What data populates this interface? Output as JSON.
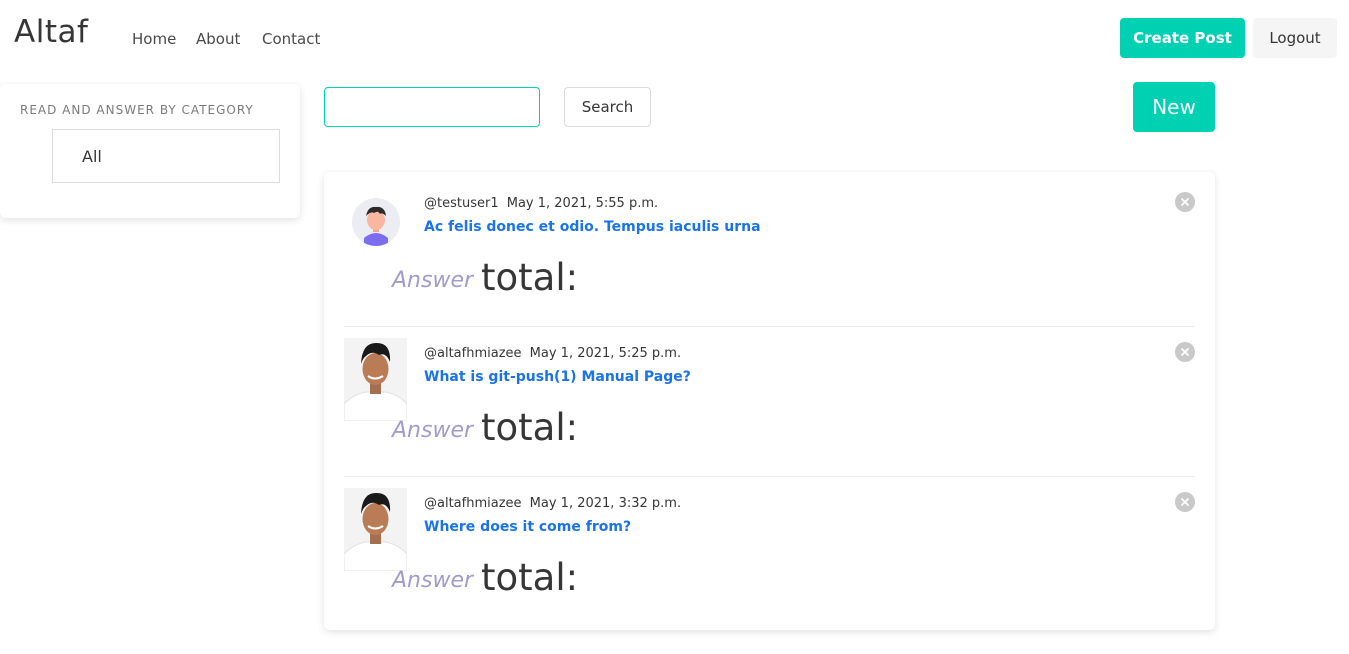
{
  "navbar": {
    "brand": "Altaf",
    "links": [
      "Home",
      "About",
      "Contact"
    ],
    "create_post_label": "Create Post",
    "logout_label": "Logout"
  },
  "sidebar": {
    "title": "Read and Answer by Category",
    "items": [
      "All"
    ]
  },
  "search": {
    "value": "",
    "placeholder": "",
    "button_label": "Search"
  },
  "new_button_label": "New",
  "posts": [
    {
      "username": "@testuser1",
      "date": "May 1, 2021, 5:55 p.m.",
      "title": "Ac felis donec et odio. Tempus iaculis urna",
      "answer_label": "Answer",
      "total_label": "total:",
      "avatar": "default-avatar"
    },
    {
      "username": "@altafhmiazee",
      "date": "May 1, 2021, 5:25 p.m.",
      "title": "What is git-push(1) Manual Page?",
      "answer_label": "Answer",
      "total_label": "total:",
      "avatar": "user-photo"
    },
    {
      "username": "@altafhmiazee",
      "date": "May 1, 2021, 3:32 p.m.",
      "title": "Where does it come from?",
      "answer_label": "Answer",
      "total_label": "total:",
      "avatar": "user-photo"
    }
  ],
  "colors": {
    "primary": "#00d1b2",
    "link": "#1a73e8",
    "answer_label": "#a39acc",
    "text": "#363636"
  }
}
